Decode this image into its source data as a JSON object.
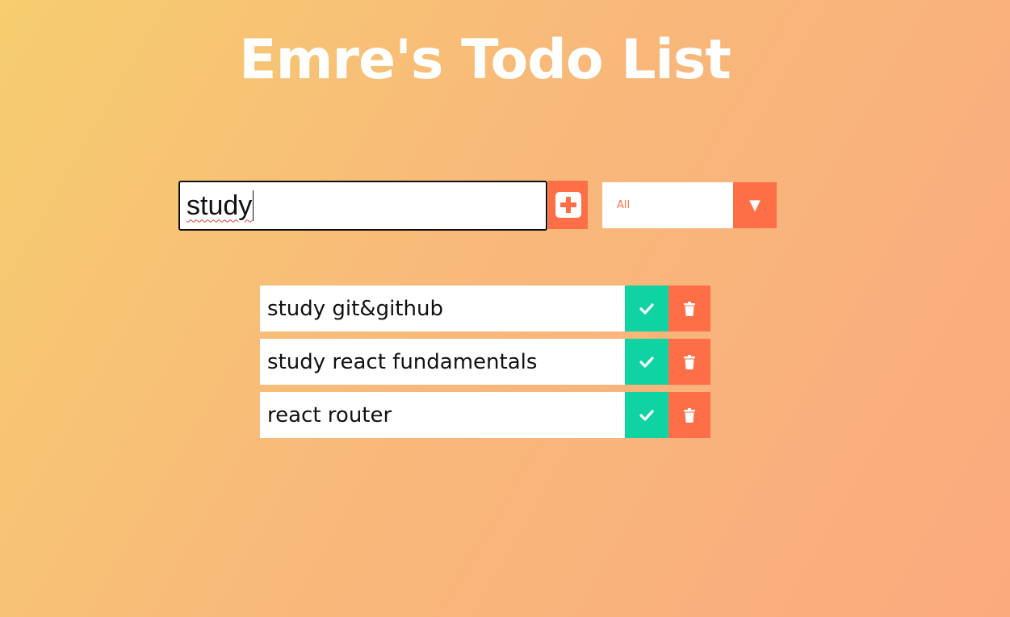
{
  "header": {
    "title": "Emre's Todo List"
  },
  "form": {
    "input_value": "study",
    "add_button_icon": "plus-square-icon",
    "filter": {
      "selected": "All",
      "arrow_icon": "caret-down-icon",
      "arrow_glyph": "▼"
    }
  },
  "todos": [
    {
      "text": "study git&github",
      "complete_icon": "check-icon",
      "delete_icon": "trash-icon"
    },
    {
      "text": "study react fundamentals",
      "complete_icon": "check-icon",
      "delete_icon": "trash-icon"
    },
    {
      "text": "react router",
      "complete_icon": "check-icon",
      "delete_icon": "trash-icon"
    }
  ],
  "colors": {
    "accent": "#ff6f47",
    "complete": "#0fd3a2",
    "background_start": "#f6cd6f",
    "background_end": "#fbaa7e"
  }
}
